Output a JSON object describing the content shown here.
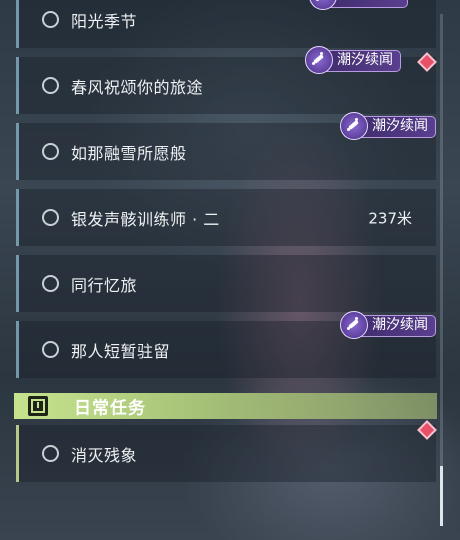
{
  "quests": [
    {
      "title": "阳光季节"
    },
    {
      "title": "春风祝颂你的旅途"
    },
    {
      "title": "如那融雪所愿般"
    },
    {
      "title": "银发声骸训练师 · 二",
      "distance": "237米"
    },
    {
      "title": "同行忆旅"
    },
    {
      "title": "那人短暂驻留"
    }
  ],
  "badge_label": "潮汐续闻",
  "daily_section": {
    "title": "日常任务",
    "quests": [
      {
        "title": "消灭残象"
      }
    ]
  }
}
